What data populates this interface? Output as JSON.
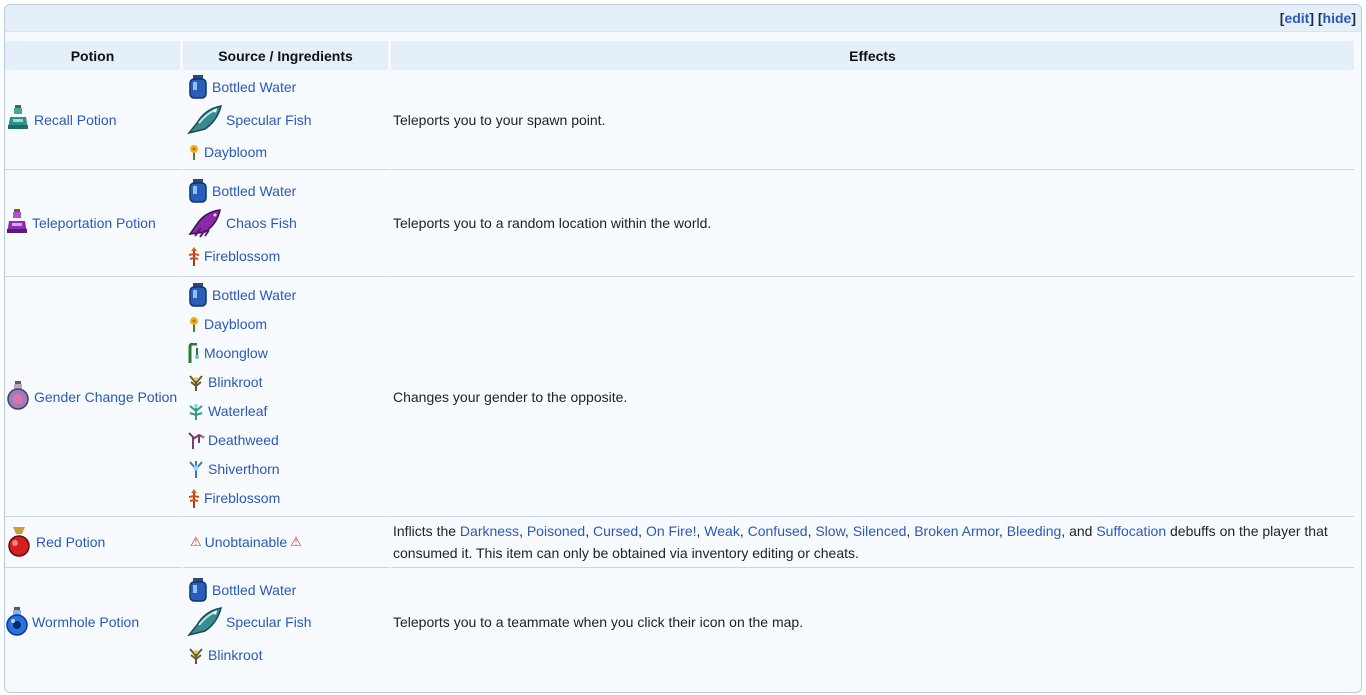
{
  "toolbar": {
    "open_bracket": "[",
    "edit": "edit",
    "middle": "] [",
    "hide": "hide",
    "close_bracket": "]"
  },
  "table": {
    "headers": [
      "Potion",
      "Source / Ingredients",
      "Effects"
    ],
    "rows": [
      {
        "potion": "Recall Potion",
        "ingredients": [
          "Bottled Water",
          "Specular Fish",
          "Daybloom"
        ],
        "effect": "Teleports you to your spawn point."
      },
      {
        "potion": "Teleportation Potion",
        "ingredients": [
          "Bottled Water",
          "Chaos Fish",
          "Fireblossom"
        ],
        "effect": "Teleports you to a random location within the world."
      },
      {
        "potion": "Gender Change Potion",
        "ingredients": [
          "Bottled Water",
          "Daybloom",
          "Moonglow",
          "Blinkroot",
          "Waterleaf",
          "Deathweed",
          "Shiverthorn",
          "Fireblossom"
        ],
        "effect": "Changes your gender to the opposite."
      },
      {
        "potion": "Red Potion",
        "source": "Unobtainable",
        "effect_intro": "Inflicts the ",
        "debuffs": [
          "Darkness",
          "Poisoned",
          "Cursed",
          "On Fire!",
          "Weak",
          "Confused",
          "Slow",
          "Silenced",
          "Broken Armor",
          "Bleeding"
        ],
        "effect_and": ", and ",
        "debuff_last": "Suffocation",
        "effect_outro": " debuffs on the player that consumed it. This item can only be obtained via inventory editing or cheats."
      },
      {
        "potion": "Wormhole Potion",
        "ingredients": [
          "Bottled Water",
          "Specular Fish",
          "Blinkroot"
        ],
        "effect": "Teleports you to a teammate when you click their icon on the map."
      }
    ]
  }
}
